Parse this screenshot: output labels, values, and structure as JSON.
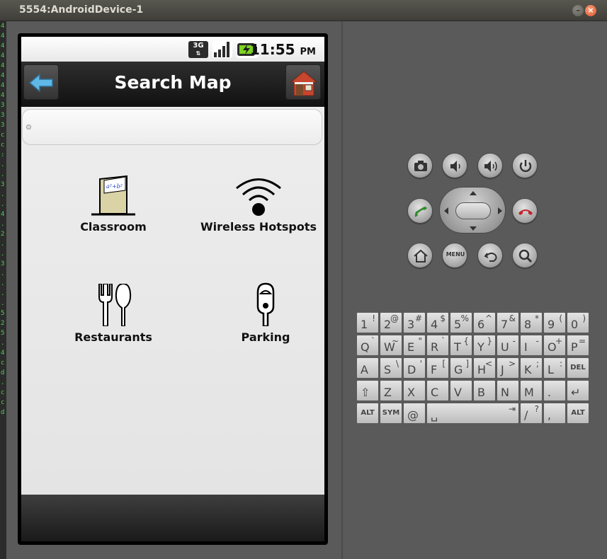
{
  "window": {
    "title": "5554:AndroidDevice-1",
    "minimize": "–",
    "close": "×"
  },
  "console_digits": [
    "4",
    "4",
    "4",
    "4",
    "4",
    "4",
    "4",
    "4",
    "3",
    "3",
    "3",
    "c",
    "c",
    ":",
    ".",
    ".",
    "3",
    ".",
    ".",
    "4",
    ".",
    "2",
    ".",
    ".",
    "3",
    ".",
    ".",
    ".",
    ".",
    "5",
    "2",
    "5",
    ".",
    "4",
    "c",
    "d",
    ".",
    "c",
    "c",
    "d"
  ],
  "statusbar": {
    "network": "3G",
    "time": "11:55",
    "ampm": "PM"
  },
  "actionbar": {
    "title": "Search Map"
  },
  "search": {
    "placeholder": ""
  },
  "categories": [
    {
      "label": "Classroom",
      "icon": "classroom-icon",
      "board_text": "a²+b²"
    },
    {
      "label": "Wireless Hotspots",
      "icon": "wifi-icon"
    },
    {
      "label": "Restaurants",
      "icon": "fork-knife-icon"
    },
    {
      "label": "Parking",
      "icon": "parking-meter-icon"
    }
  ],
  "hw_buttons": {
    "camera": "camera-icon",
    "vol_down": "volume-down-icon",
    "vol_up": "volume-up-icon",
    "power": "power-icon",
    "call": "call-icon",
    "end_call": "end-call-icon",
    "home": "home-icon",
    "menu": "MENU",
    "back": "back-icon",
    "search": "search-icon"
  },
  "keyboard": {
    "row1": [
      {
        "m": "1",
        "s": "!"
      },
      {
        "m": "2",
        "s": "@"
      },
      {
        "m": "3",
        "s": "#"
      },
      {
        "m": "4",
        "s": "$"
      },
      {
        "m": "5",
        "s": "%"
      },
      {
        "m": "6",
        "s": "^"
      },
      {
        "m": "7",
        "s": "&"
      },
      {
        "m": "8",
        "s": "*"
      },
      {
        "m": "9",
        "s": "("
      },
      {
        "m": "0",
        "s": ")"
      }
    ],
    "row2": [
      {
        "m": "Q",
        "s": "`"
      },
      {
        "m": "W",
        "s": "~"
      },
      {
        "m": "E",
        "s": "\""
      },
      {
        "m": "R",
        "s": "`"
      },
      {
        "m": "T",
        "s": "{"
      },
      {
        "m": "Y",
        "s": "}"
      },
      {
        "m": "U",
        "s": "-"
      },
      {
        "m": "I",
        "s": "-"
      },
      {
        "m": "O",
        "s": "+"
      },
      {
        "m": "P",
        "s": "="
      }
    ],
    "row3": [
      {
        "m": "A",
        "s": ""
      },
      {
        "m": "S",
        "s": "\\"
      },
      {
        "m": "D",
        "s": "'"
      },
      {
        "m": "F",
        "s": "["
      },
      {
        "m": "G",
        "s": "]"
      },
      {
        "m": "H",
        "s": "<"
      },
      {
        "m": "J",
        "s": ">"
      },
      {
        "m": "K",
        "s": ";"
      },
      {
        "m": "L",
        "s": ":"
      },
      {
        "m": "",
        "s": "",
        "special": "DEL"
      }
    ],
    "row4": [
      {
        "m": "⇧",
        "s": ""
      },
      {
        "m": "Z",
        "s": ""
      },
      {
        "m": "X",
        "s": ""
      },
      {
        "m": "C",
        "s": ""
      },
      {
        "m": "V",
        "s": ""
      },
      {
        "m": "B",
        "s": ""
      },
      {
        "m": "N",
        "s": ""
      },
      {
        "m": "M",
        "s": ""
      },
      {
        "m": ".",
        "s": ""
      },
      {
        "m": "↵",
        "s": ""
      }
    ],
    "row5": {
      "alt_left": "ALT",
      "sym": "SYM",
      "at": "@",
      "space": "␣",
      "tab": "⇥",
      "slash": "/",
      "question": "?",
      "comma": ",",
      "alt_right": "ALT"
    }
  }
}
